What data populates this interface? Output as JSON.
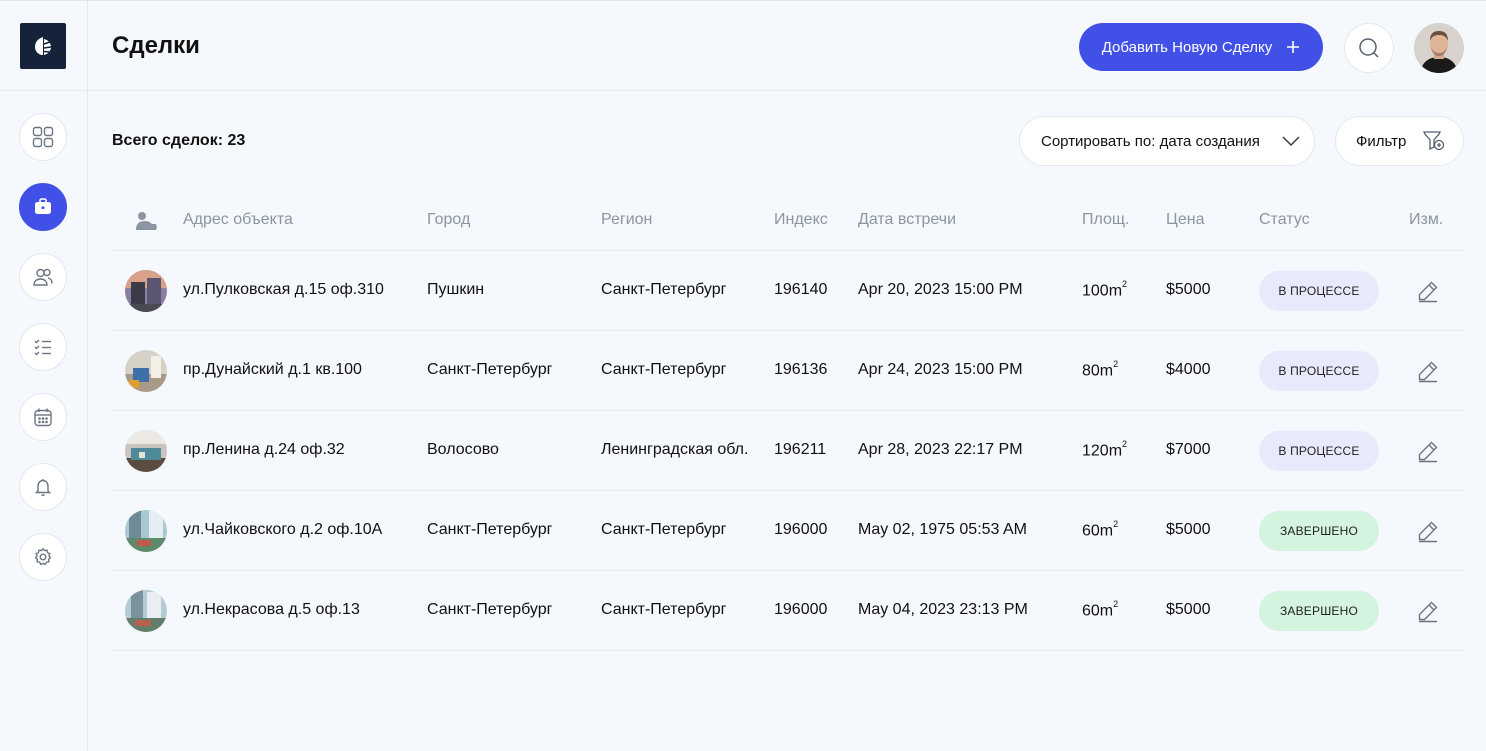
{
  "app": {
    "title": "Сделки"
  },
  "sidebar": {
    "items": [
      {
        "name": "dashboard",
        "icon": "grid-icon",
        "active": false
      },
      {
        "name": "deals",
        "icon": "briefcase-icon",
        "active": true
      },
      {
        "name": "clients",
        "icon": "users-icon",
        "active": false
      },
      {
        "name": "tasks",
        "icon": "checklist-icon",
        "active": false
      },
      {
        "name": "calendar",
        "icon": "calendar-icon",
        "active": false
      },
      {
        "name": "notifications",
        "icon": "bell-icon",
        "active": false
      },
      {
        "name": "settings",
        "icon": "gear-icon",
        "active": false
      }
    ]
  },
  "header": {
    "add_button": "Добавить Новую Сделку",
    "search_icon": "search-icon",
    "avatar": "user-avatar"
  },
  "toolbar": {
    "total": "Всего сделок: 23",
    "sort_label": "Сортировать по: дата создания",
    "filter_label": "Фильтр"
  },
  "table": {
    "columns": [
      "Адрес объекта",
      "Город",
      "Регион",
      "Индекс",
      "Дата встречи",
      "Площ.",
      "Цена",
      "Статус",
      "Изм."
    ],
    "rows": [
      {
        "address": "ул.Пулковская д.15 оф.310",
        "city": "Пушкин",
        "region": "Санкт-Петербург",
        "zip": "196140",
        "date": "Apr 20, 2023 15:00 PM",
        "area": "100m",
        "area_unit": "2",
        "price": "$5000",
        "status": "В ПРОЦЕССЕ",
        "status_kind": "progress"
      },
      {
        "address": "пр.Дунайский д.1 кв.100",
        "city": "Санкт-Петербург",
        "region": "Санкт-Петербург",
        "zip": "196136",
        "date": "Apr 24, 2023 15:00 PM",
        "area": "80m",
        "area_unit": "2",
        "price": "$4000",
        "status": "В ПРОЦЕССЕ",
        "status_kind": "progress"
      },
      {
        "address": "пр.Ленина д.24 оф.32",
        "city": "Волосово",
        "region": "Ленинградская обл.",
        "zip": "196211",
        "date": "Apr 28, 2023 22:17 PM",
        "area": "120m",
        "area_unit": "2",
        "price": "$7000",
        "status": "В ПРОЦЕССЕ",
        "status_kind": "progress"
      },
      {
        "address": "ул.Чайковского д.2 оф.10А",
        "city": "Санкт-Петербург",
        "region": "Санкт-Петербург",
        "zip": "196000",
        "date": "May 02, 1975 05:53 AM",
        "area": "60m",
        "area_unit": "2",
        "price": "$5000",
        "status": "ЗАВЕРШЕНО",
        "status_kind": "done"
      },
      {
        "address": "ул.Некрасова д.5 оф.13",
        "city": "Санкт-Петербург",
        "region": "Санкт-Петербург",
        "zip": "196000",
        "date": "May 04, 2023 23:13 PM",
        "area": "60m",
        "area_unit": "2",
        "price": "$5000",
        "status": "ЗАВЕРШЕНО",
        "status_kind": "done"
      }
    ]
  },
  "colors": {
    "accent": "#4150e6",
    "status_progress_bg": "#e8eafc",
    "status_done_bg": "#d4f4df"
  }
}
